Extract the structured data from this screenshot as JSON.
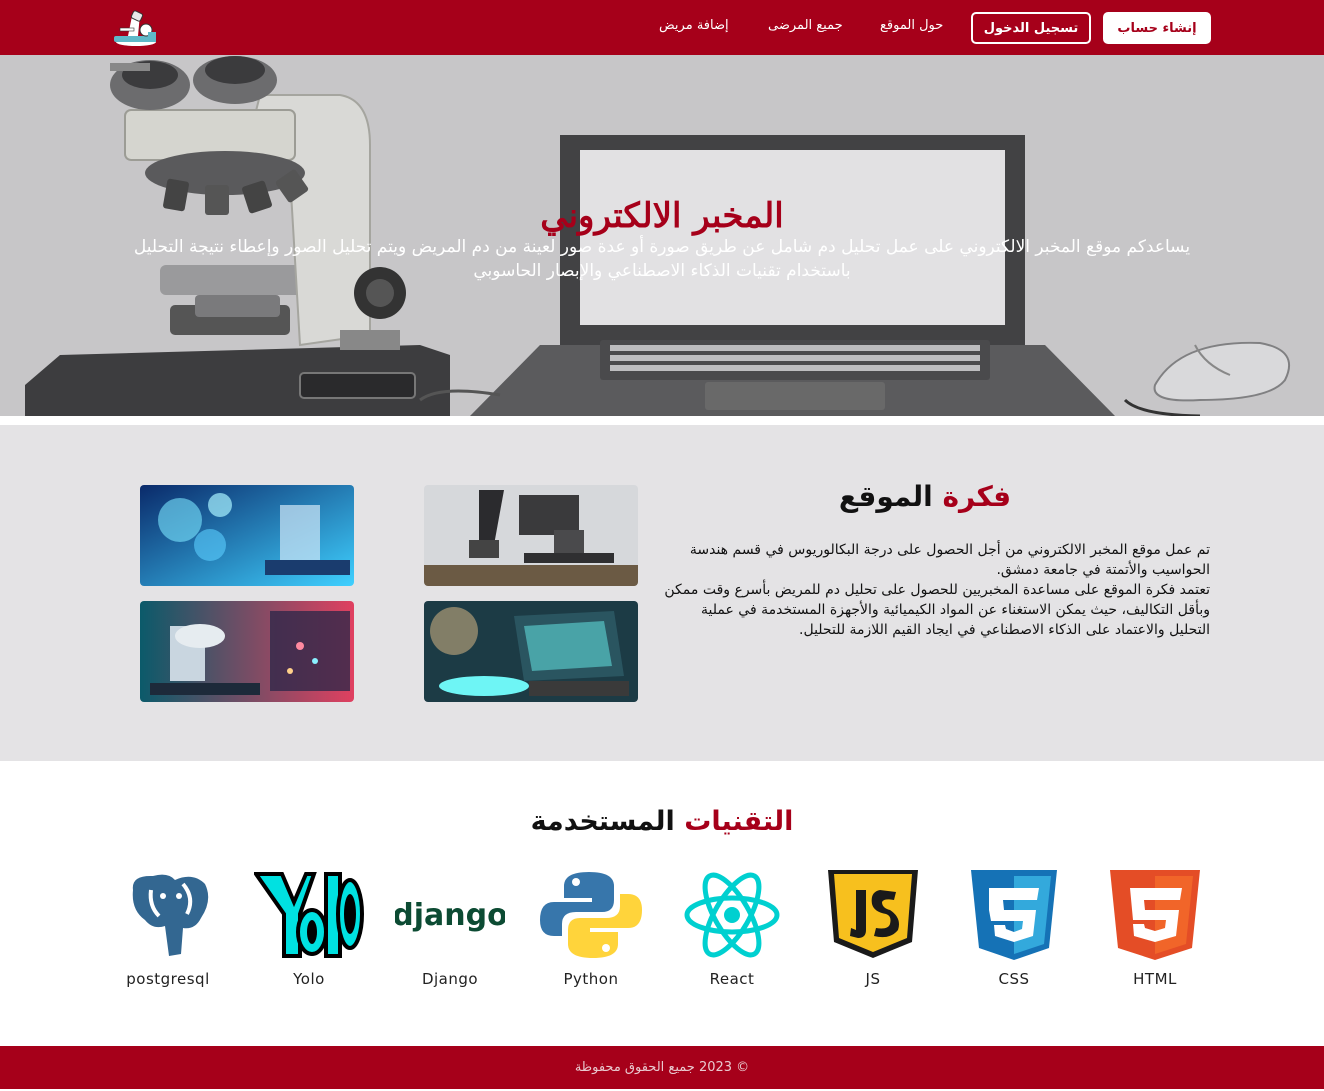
{
  "nav": {
    "signup": "إنشاء حساب",
    "login": "تسجيل الدخول",
    "links": [
      "حول الموقع",
      "جميع المرضى",
      "إضافة مريض"
    ]
  },
  "hero": {
    "title": "المخبر الالكتروني",
    "description": "يساعدكم موقع المخبر الالكتروني على عمل تحليل دم شامل عن طريق صورة أو عدة صور لعينة من دم المريض ويتم تحليل الصور وإعطاء نتيجة التحليل باستخدام تقنيات الذكاء الاصطناعي والإبصار الحاسوبي"
  },
  "idea": {
    "title_accent": "فكرة",
    "title_rest": "الموقع",
    "paragraph_1": "تم عمل موقع المخبر الالكتروني من أجل الحصول على درجة البكالوريوس في قسم هندسة الحواسيب والأتمتة في جامعة دمشق.",
    "paragraph_2": "تعتمد فكرة الموقع على مساعدة المخبريين للحصول على تحليل دم للمريض بأسرع وقت ممكن وبأقل التكاليف، حيث يمكن الاستغناء عن المواد الكيميائية والأجهزة المستخدمة في عملية التحليل والاعتماد على الذكاء الاصطناعي في ايجاد القيم اللازمة للتحليل."
  },
  "tech": {
    "title_accent": "التقنيات",
    "title_rest": "المستخدمة",
    "items": [
      {
        "label": "HTML",
        "icon": "html5-icon",
        "color": "#f16529"
      },
      {
        "label": "CSS",
        "icon": "css3-icon",
        "color": "#2965f1"
      },
      {
        "label": "JS",
        "icon": "js-icon",
        "color": "#f7df1e"
      },
      {
        "label": "React",
        "icon": "react-icon",
        "color": "#00d8d8"
      },
      {
        "label": "Python",
        "icon": "python-icon",
        "color": "#3776ab"
      },
      {
        "label": "Django",
        "icon": "django-icon",
        "color": "#0c4b33"
      },
      {
        "label": "Yolo",
        "icon": "yolo-icon",
        "color": "#00e5e5"
      },
      {
        "label": "postgresql",
        "icon": "postgresql-icon",
        "color": "#336791"
      }
    ]
  },
  "footer": {
    "text": "© 2023 جميع الحقوق محفوظة"
  },
  "colors": {
    "brand": "#a6001a",
    "hero_bg": "#c7c6c8",
    "section_bg": "#e4e3e5"
  }
}
